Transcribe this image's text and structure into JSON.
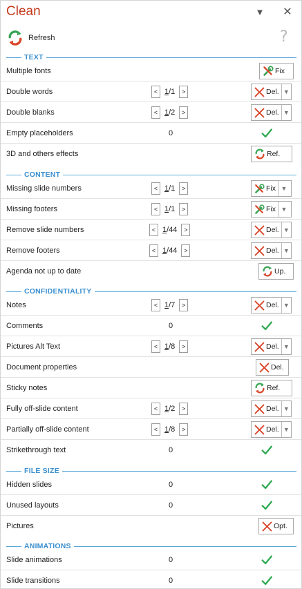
{
  "pane": {
    "title": "Clean",
    "menu_glyph": "▼",
    "close_glyph": "✕",
    "refresh_label": "Refresh",
    "help_glyph": "?"
  },
  "sections": {
    "text": "TEXT",
    "content": "CONTENT",
    "confidentiality": "CONFIDENTIALITY",
    "file_size": "FILE SIZE",
    "animations": "ANIMATIONS"
  },
  "rows": {
    "multiple_fonts": {
      "label": "Multiple fonts",
      "action": "Fix",
      "icon": "wrench-icon"
    },
    "double_words": {
      "label": "Double words",
      "current": "1",
      "total": "/1",
      "action": "Del.",
      "icon": "delete-x-icon"
    },
    "double_blanks": {
      "label": "Double blanks",
      "current": "1",
      "total": "/2",
      "action": "Del.",
      "icon": "delete-x-icon"
    },
    "empty_placeholders": {
      "label": "Empty placeholders",
      "count": "0",
      "status": "ok"
    },
    "effects_3d": {
      "label": "3D and others effects",
      "action": "Ref.",
      "icon": "refresh-icon"
    },
    "missing_slide_numbers": {
      "label": "Missing slide numbers",
      "current": "1",
      "total": "/1",
      "action": "Fix",
      "icon": "wrench-icon"
    },
    "missing_footers": {
      "label": "Missing footers",
      "current": "1",
      "total": "/1",
      "action": "Fix",
      "icon": "wrench-icon"
    },
    "remove_slide_numbers": {
      "label": "Remove slide numbers",
      "current": "1",
      "total": "/44",
      "action": "Del.",
      "icon": "delete-x-icon"
    },
    "remove_footers": {
      "label": "Remove footers",
      "current": "1",
      "total": "/44",
      "action": "Del.",
      "icon": "delete-x-icon"
    },
    "agenda": {
      "label": "Agenda not up to date",
      "action": "Up.",
      "icon": "refresh-icon"
    },
    "notes": {
      "label": "Notes",
      "current": "1",
      "total": "/7",
      "action": "Del.",
      "icon": "delete-x-icon"
    },
    "comments": {
      "label": "Comments",
      "count": "0",
      "status": "ok"
    },
    "pictures_alt": {
      "label": "Pictures Alt Text",
      "current": "1",
      "total": "/8",
      "action": "Del.",
      "icon": "delete-x-icon"
    },
    "doc_props": {
      "label": "Document properties",
      "action": "Del.",
      "icon": "delete-x-icon"
    },
    "sticky_notes": {
      "label": "Sticky notes",
      "action": "Ref.",
      "icon": "refresh-icon"
    },
    "fully_off": {
      "label": "Fully off-slide content",
      "current": "1",
      "total": "/2",
      "action": "Del.",
      "icon": "delete-x-icon"
    },
    "partially_off": {
      "label": "Partially off-slide content",
      "current": "1",
      "total": "/8",
      "action": "Del.",
      "icon": "delete-x-icon"
    },
    "strikethrough": {
      "label": "Strikethrough text",
      "count": "0",
      "status": "ok"
    },
    "hidden_slides": {
      "label": "Hidden slides",
      "count": "0",
      "status": "ok"
    },
    "unused_layouts": {
      "label": "Unused layouts",
      "count": "0",
      "status": "ok"
    },
    "pictures": {
      "label": "Pictures",
      "action": "Opt.",
      "icon": "delete-x-icon"
    },
    "slide_animations": {
      "label": "Slide animations",
      "count": "0",
      "status": "ok"
    },
    "slide_transitions": {
      "label": "Slide transitions",
      "count": "0",
      "status": "ok"
    }
  },
  "nav": {
    "prev_glyph": "<",
    "next_glyph": ">"
  },
  "colors": {
    "title": "#c43b1d",
    "section": "#3a8fd0",
    "check": "#2eaa52",
    "delete": "#d9472b",
    "wrench_green": "#3aa556",
    "wrench_red": "#d9472b"
  }
}
